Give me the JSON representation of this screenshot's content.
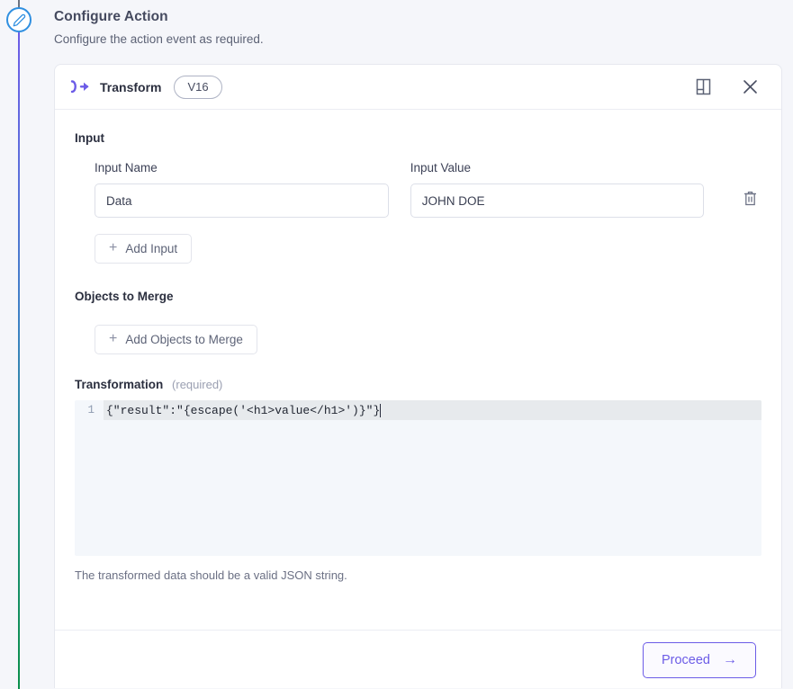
{
  "page": {
    "title": "Configure Action",
    "subtitle": "Configure the action event as required.",
    "step_icon": "pencil-icon"
  },
  "card": {
    "header": {
      "brand_icon": "transform-icon",
      "title": "Transform",
      "version": "V16",
      "docs_icon": "book-icon",
      "close_icon": "close-icon"
    },
    "input_section": {
      "label": "Input",
      "col_name_label": "Input Name",
      "col_value_label": "Input Value",
      "rows": [
        {
          "name": "Data",
          "value": "JOHN DOE",
          "delete_icon": "trash-icon"
        }
      ],
      "add_button": "Add Input",
      "name_placeholder": "Input Name",
      "value_placeholder": "Input Value"
    },
    "merge_section": {
      "label": "Objects to Merge",
      "add_button": "Add Objects to Merge"
    },
    "transformation_section": {
      "label": "Transformation",
      "required_note": "(required)",
      "line_number": "1",
      "code": "{\"result\":\"{escape('<h1>value</h1>')}\"}",
      "helper_text": "The transformed data should be a valid JSON string."
    },
    "footer": {
      "proceed_label": "Proceed",
      "proceed_arrow": "→"
    }
  },
  "colors": {
    "accent": "#6c5ce7",
    "page_bg": "#f5f6fa",
    "card_bg": "#ffffff",
    "editor_bg": "#f4f7fb",
    "rail_top": "#6c5ce7",
    "rail_bottom": "#0a8f4a",
    "badge_border": "#2f8fe0"
  }
}
